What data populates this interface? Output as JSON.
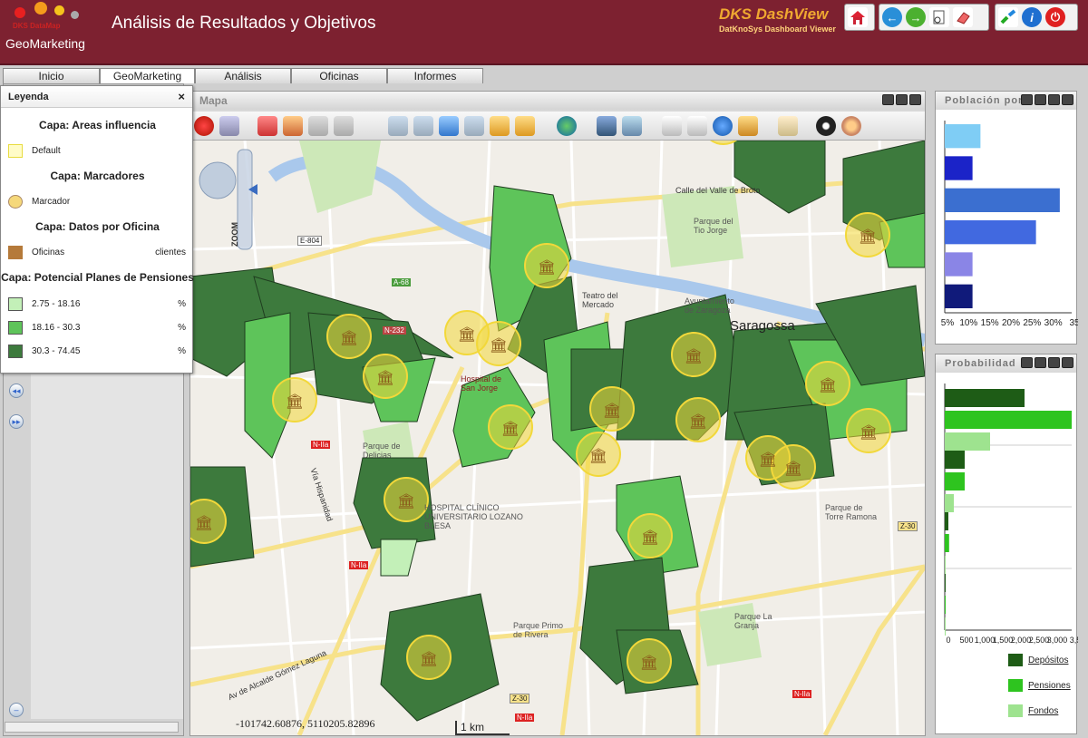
{
  "header": {
    "logo_text": "GeoMarketing",
    "logo_small": "DKS DataMap",
    "title": "Análisis de Resultados y Objetivos",
    "brand": "DKS DashView",
    "brand_sub": "DatKnoSys Dashboard Viewer"
  },
  "tabs": [
    {
      "label": "Inicio"
    },
    {
      "label": "GeoMarketing"
    },
    {
      "label": "Análisis"
    },
    {
      "label": "Oficinas"
    },
    {
      "label": "Informes"
    }
  ],
  "legend": {
    "title": "Leyenda",
    "close": "×",
    "layer1_caption": "Capa:  Areas influencia",
    "layer1_item": "Default",
    "layer2_caption": "Capa:  Marcadores",
    "layer2_item": "Marcador",
    "layer3_caption": "Capa:  Datos por Oficina",
    "layer3_item": "Oficinas",
    "layer3_value": "clientes",
    "layer4_caption": "Capa:  Potencial Planes de Pensiones",
    "ranges": [
      {
        "label": "2.75 - 18.16",
        "unit": "%",
        "color": "#c3f0b8"
      },
      {
        "label": "18.16 - 30.3",
        "unit": "%",
        "color": "#5ec45a"
      },
      {
        "label": "30.3 - 74.45",
        "unit": "%",
        "color": "#3d7a3d"
      }
    ]
  },
  "map": {
    "window_title": "Mapa",
    "coords": "-101742.60876, 5110205.82896",
    "scale": "1 km",
    "zoom_label": "ZOOM",
    "labels": {
      "city": "Saragossa",
      "n232": "N-232",
      "e804": "E-804",
      "a68": "A-68",
      "n2a_1": "N-IIa",
      "n2a_2": "N-IIa",
      "n2a_3": "N-IIa",
      "n2a_4": "N-IIa",
      "z30_1": "Z-30",
      "z30_2": "Z-30",
      "teatro": "Teatro del Mercado",
      "hospital": "Hospital de San Jorge",
      "clinico": "HOSPITAL CLÍNICO UNIVERSITARIO LOZANO BLESA",
      "delicias": "Parque de Delicias",
      "tio_jorge": "Parque del Tio Jorge",
      "valle_broto": "Calle del Valle de Broto",
      "primo_rivera": "Parque Primo de Rivera",
      "torre_ramona": "Parque de Torre Ramona",
      "la_granja": "Parque La Granja",
      "ayuntamiento": "Ayuntamiento de Zaragoza",
      "via_hispanidad": "Vía Hispanidad",
      "gomez_laguna": "Av de Alcalde Gómez Laguna"
    }
  },
  "right_panels": {
    "poblacion_title": "Población por",
    "poblacion_axis": [
      "5%",
      "10%",
      "15%",
      "20%",
      "25%",
      "30%",
      "35"
    ],
    "probabilidad_title": "Probabilidad",
    "probabilidad_axis": [
      "0",
      "500",
      "1,000",
      "1,500",
      "2,000",
      "2,500",
      "3,000",
      "3,5"
    ],
    "legend": [
      {
        "label": "Depósitos",
        "color": "#1e5c16"
      },
      {
        "label": "Pensiones",
        "color": "#2ec41f"
      },
      {
        "label": "Fondos",
        "color": "#9ee38f"
      }
    ]
  },
  "chart_data": [
    {
      "type": "bar",
      "title": "Población por",
      "orientation": "horizontal",
      "values": [
        12,
        10,
        32,
        26,
        10,
        10
      ],
      "colors": [
        "#7fcdf5",
        "#1b23c8",
        "#3b6fd0",
        "#4169e0",
        "#8a85e6",
        "#101a7a"
      ],
      "xlim": [
        3,
        35
      ],
      "ticks": [
        "5%",
        "10%",
        "15%",
        "20%",
        "25%",
        "30%",
        "35"
      ]
    },
    {
      "type": "bar",
      "title": "Probabilidad",
      "orientation": "horizontal",
      "groups": 4,
      "series": [
        {
          "name": "Depósitos",
          "values": [
            2200,
            550,
            100,
            20
          ]
        },
        {
          "name": "Pensiones",
          "values": [
            3500,
            550,
            120,
            20
          ]
        },
        {
          "name": "Fondos",
          "values": [
            1250,
            250,
            20,
            10
          ]
        }
      ],
      "xlim": [
        0,
        3500
      ],
      "ticks": [
        "0",
        "500",
        "1,000",
        "1,500",
        "2,000",
        "2,500",
        "3,000",
        "3,5"
      ]
    }
  ]
}
